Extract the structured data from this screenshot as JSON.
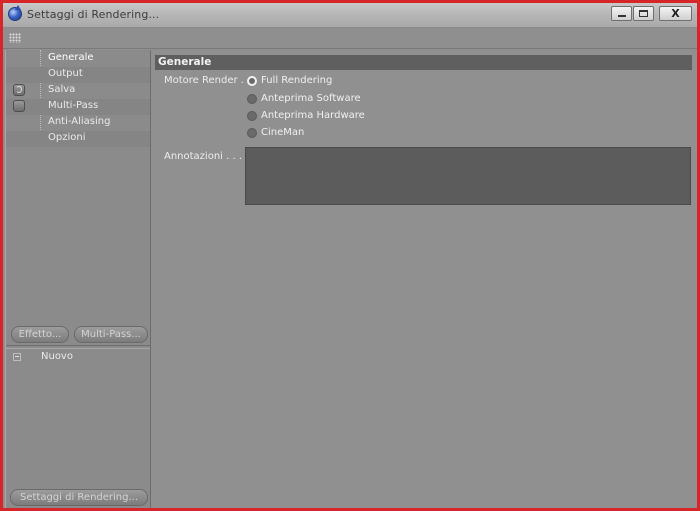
{
  "window": {
    "title": "Settaggi di Rendering...",
    "close_glyph": "X",
    "frame_color": "#d6262a"
  },
  "icons": {
    "app": "cinema4d-app-icon",
    "toolbar": "grip-dots-icon"
  },
  "sidebar": {
    "items": [
      {
        "label": "Generale",
        "selected": true
      },
      {
        "label": "Output"
      },
      {
        "label": "Salva",
        "toggle": "on"
      },
      {
        "label": "Multi-Pass",
        "toggle": "off"
      },
      {
        "label": "Anti-Aliasing"
      },
      {
        "label": "Opzioni"
      }
    ],
    "buttons": {
      "effect": "Effetto...",
      "multipass": "Multi-Pass..."
    },
    "list": {
      "items": [
        {
          "label": "Nuovo"
        }
      ]
    },
    "bottom_button": "Settaggi di Rendering..."
  },
  "main": {
    "section_title": "Generale",
    "engine": {
      "label": "Motore Render . .",
      "options": [
        {
          "label": "Full Rendering",
          "checked": true
        },
        {
          "label": "Anteprima Software",
          "checked": false
        },
        {
          "label": "Anteprima Hardware",
          "checked": false
        },
        {
          "label": "CineMan",
          "checked": false
        }
      ]
    },
    "notes": {
      "label": "Annotazioni . . . .",
      "value": ""
    }
  }
}
